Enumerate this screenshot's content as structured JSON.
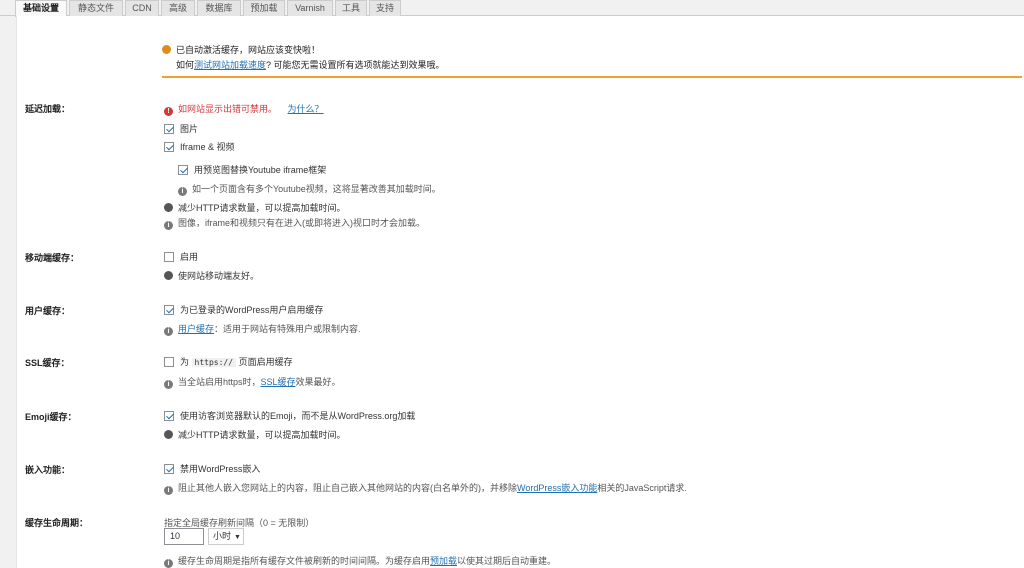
{
  "tabs": [
    {
      "label": "基础设置",
      "active": true
    },
    {
      "label": "静态文件",
      "active": false
    },
    {
      "label": "CDN",
      "active": false
    },
    {
      "label": "高级",
      "active": false
    },
    {
      "label": "数据库",
      "active": false
    },
    {
      "label": "预加载",
      "active": false
    },
    {
      "label": "Varnish",
      "active": false
    },
    {
      "label": "工具",
      "active": false
    },
    {
      "label": "支持",
      "active": false
    }
  ],
  "notice": {
    "line1": "已自动激活缓存，网站应该变快啦！",
    "line2_prefix": "如何",
    "line2_link": "测试网站加载速度",
    "line2_suffix": "? 可能您无需设置所有选项就能达到效果哦。"
  },
  "lazyload": {
    "label": "延迟加载：",
    "warning": "如网站显示出错可禁用。",
    "why_link": "为什么？",
    "images_label": "图片",
    "iframe_label": "Iframe & 视频",
    "youtube_label": "用预览图替换Youtube iframe框架",
    "youtube_info": "如一个页面含有多个Youtube视频，这将显著改善其加载时间。",
    "tip1": "减少HTTP请求数量，可以提高加载时间。",
    "tip2": "图像，iframe和视频只有在进入(或即将进入)视口时才会加载。"
  },
  "mobile": {
    "label": "移动端缓存：",
    "checkbox_label": "启用",
    "tip": "使网站移动端友好。"
  },
  "user_cache": {
    "label": "用户缓存：",
    "checkbox_label": "为已登录的WordPress用户启用缓存",
    "info_link": "用户缓存",
    "info_text": "：适用于网站有特殊用户或限制内容."
  },
  "ssl": {
    "label": "SSL缓存：",
    "prefix": "为",
    "code": "https://",
    "suffix": "页面启用缓存",
    "info_prefix": "当全站启用https时，",
    "info_link": "SSL缓存",
    "info_suffix": "效果最好。"
  },
  "emoji": {
    "label": "Emoji缓存：",
    "checkbox_label": "使用访客浏览器默认的Emoji，而不是从WordPress.org加载",
    "tip": "减少HTTP请求数量，可以提高加载时间。"
  },
  "embeds": {
    "label": "嵌入功能：",
    "checkbox_label": "禁用WordPress嵌入",
    "info_prefix": "阻止其他人嵌入您网站上的内容，阻止自己嵌入其他网站的内容(白名单外的)，并移除",
    "info_link": "WordPress嵌入功能",
    "info_suffix": "相关的JavaScript请求."
  },
  "lifespan": {
    "label": "缓存生命周期：",
    "hint": "指定全局缓存刷新间隔（0 = 无限制）",
    "value": "10",
    "unit": "小时",
    "info_prefix": "缓存生命周期是指所有缓存文件被刷新的时间间隔。为缓存启用",
    "info_link": "预加载",
    "info_suffix": "以使其过期后自动重建。"
  },
  "colors": {
    "accent": "#f0a030",
    "link": "#2271b1",
    "error": "#d63638"
  }
}
